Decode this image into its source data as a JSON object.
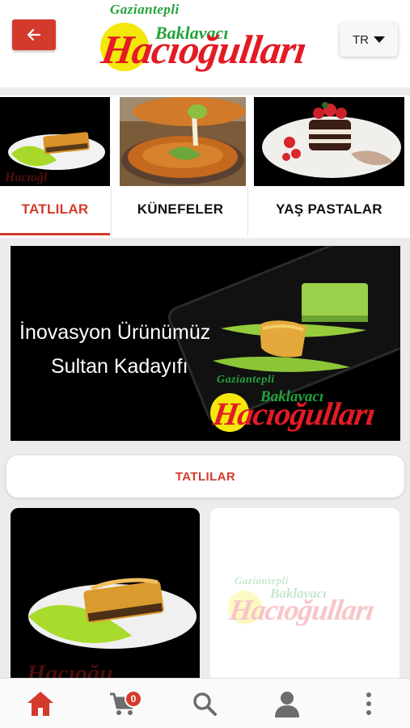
{
  "header": {
    "back_label": "",
    "logo": {
      "line1": "Gaziantepli",
      "line2": "Baklavacı",
      "line3": "Hacıoğulları"
    },
    "language": "TR"
  },
  "categories": [
    {
      "label": "TATLILAR",
      "active": true
    },
    {
      "label": "KÜNEFELER",
      "active": false
    },
    {
      "label": "YAŞ PASTALAR",
      "active": false
    }
  ],
  "banner": {
    "line1": "İnovasyon Ürünümüz",
    "line2": "Sultan Kadayıfı"
  },
  "section": {
    "title": "TATLILAR"
  },
  "cart": {
    "count": "0"
  },
  "colors": {
    "accent": "#d33a2c",
    "logo_green": "#22a33a",
    "logo_red": "#e21b25",
    "logo_yellow": "#f5e70c"
  },
  "icons": {
    "back": "arrow-left-icon",
    "language": "caret-down-icon",
    "home": "home-icon",
    "cart": "cart-icon",
    "search": "search-icon",
    "profile": "user-icon",
    "more": "more-vertical-icon"
  }
}
